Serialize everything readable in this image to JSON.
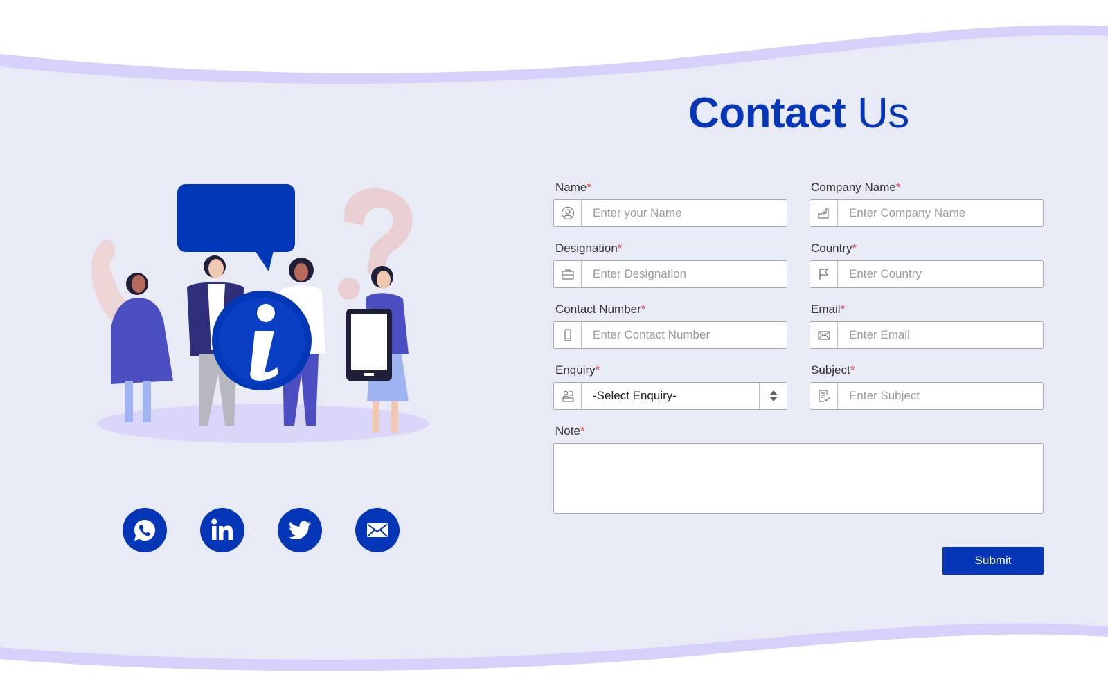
{
  "page": {
    "title_bold": "Contact",
    "title_light": "Us"
  },
  "colors": {
    "brand": "#0536b8",
    "background": "#e8eaf6",
    "wave": "#d5d1fb",
    "required": "#e53935"
  },
  "form": {
    "required_mark": "*",
    "fields": {
      "name": {
        "label": "Name",
        "placeholder": "Enter your Name",
        "icon": "user-icon"
      },
      "company": {
        "label": "Company Name",
        "placeholder": "Enter Company Name",
        "icon": "factory-icon"
      },
      "designation": {
        "label": "Designation",
        "placeholder": "Enter Designation",
        "icon": "briefcase-icon"
      },
      "country": {
        "label": "Country",
        "placeholder": "Enter Country",
        "icon": "flag-icon"
      },
      "contact": {
        "label": "Contact Number",
        "placeholder": "Enter Contact Number",
        "icon": "phone-icon"
      },
      "email": {
        "label": "Email",
        "placeholder": "Enter Email",
        "icon": "envelope-icon"
      },
      "enquiry": {
        "label": "Enquiry",
        "value": "-Select Enquiry-",
        "icon": "enquiry-icon"
      },
      "subject": {
        "label": "Subject",
        "placeholder": "Enter Subject",
        "icon": "document-check-icon"
      },
      "note": {
        "label": "Note"
      }
    },
    "submit_label": "Submit"
  },
  "social": [
    "whatsapp-icon",
    "linkedin-icon",
    "twitter-icon",
    "email-icon"
  ]
}
